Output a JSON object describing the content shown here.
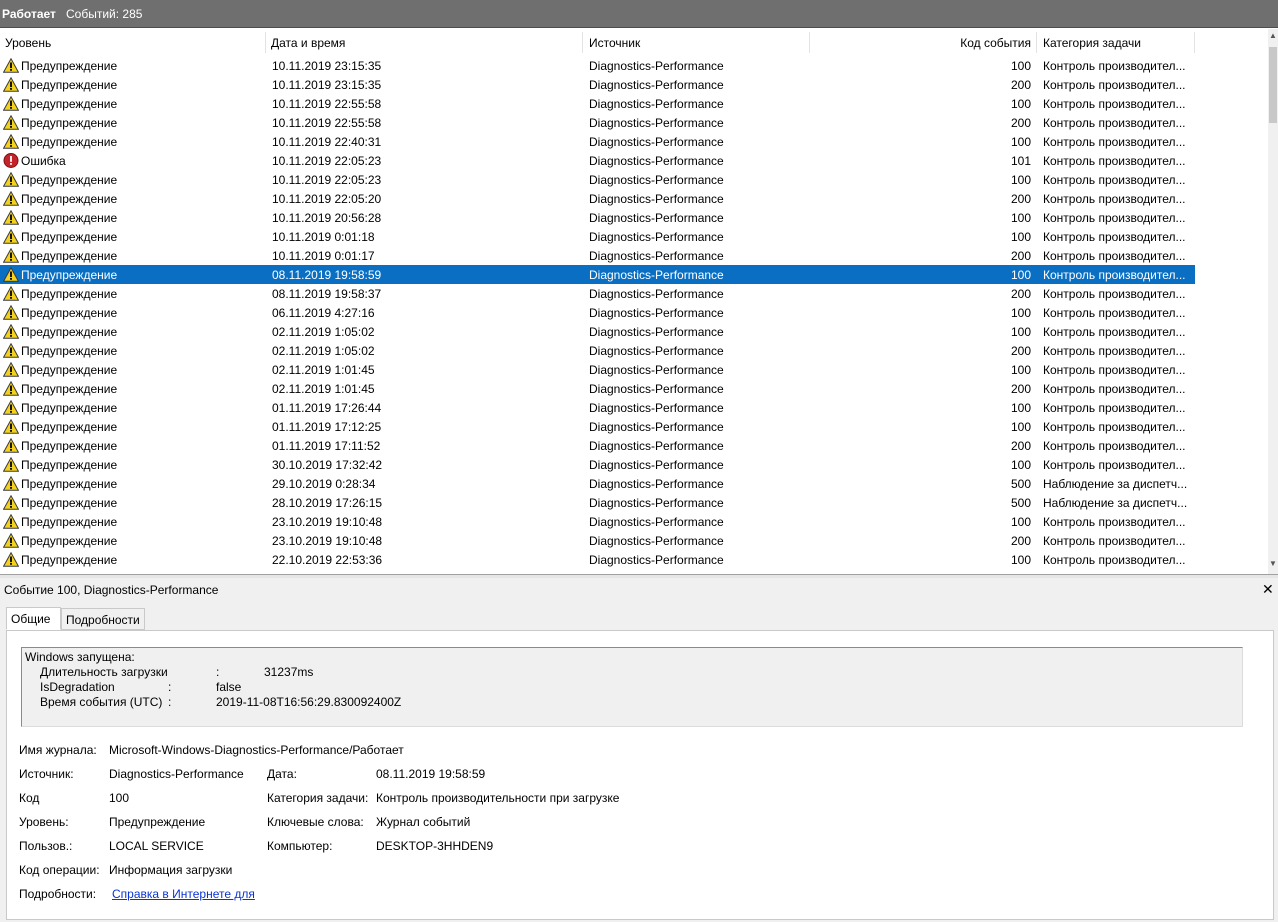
{
  "titlebar": {
    "status": "Работает",
    "events_count": "Событий: 285"
  },
  "columns": {
    "level": "Уровень",
    "date": "Дата и время",
    "source": "Источник",
    "id": "Код события",
    "category": "Категория задачи"
  },
  "rows": [
    {
      "type": "warning",
      "level": "Предупреждение",
      "date": "10.11.2019 23:15:35",
      "source": "Diagnostics-Performance",
      "id": "100",
      "category": "Контроль производител..."
    },
    {
      "type": "warning",
      "level": "Предупреждение",
      "date": "10.11.2019 23:15:35",
      "source": "Diagnostics-Performance",
      "id": "200",
      "category": "Контроль производител..."
    },
    {
      "type": "warning",
      "level": "Предупреждение",
      "date": "10.11.2019 22:55:58",
      "source": "Diagnostics-Performance",
      "id": "100",
      "category": "Контроль производител..."
    },
    {
      "type": "warning",
      "level": "Предупреждение",
      "date": "10.11.2019 22:55:58",
      "source": "Diagnostics-Performance",
      "id": "200",
      "category": "Контроль производител..."
    },
    {
      "type": "warning",
      "level": "Предупреждение",
      "date": "10.11.2019 22:40:31",
      "source": "Diagnostics-Performance",
      "id": "100",
      "category": "Контроль производител..."
    },
    {
      "type": "error",
      "level": "Ошибка",
      "date": "10.11.2019 22:05:23",
      "source": "Diagnostics-Performance",
      "id": "101",
      "category": "Контроль производител..."
    },
    {
      "type": "warning",
      "level": "Предупреждение",
      "date": "10.11.2019 22:05:23",
      "source": "Diagnostics-Performance",
      "id": "100",
      "category": "Контроль производител..."
    },
    {
      "type": "warning",
      "level": "Предупреждение",
      "date": "10.11.2019 22:05:20",
      "source": "Diagnostics-Performance",
      "id": "200",
      "category": "Контроль производител..."
    },
    {
      "type": "warning",
      "level": "Предупреждение",
      "date": "10.11.2019 20:56:28",
      "source": "Diagnostics-Performance",
      "id": "100",
      "category": "Контроль производител..."
    },
    {
      "type": "warning",
      "level": "Предупреждение",
      "date": "10.11.2019 0:01:18",
      "source": "Diagnostics-Performance",
      "id": "100",
      "category": "Контроль производител..."
    },
    {
      "type": "warning",
      "level": "Предупреждение",
      "date": "10.11.2019 0:01:17",
      "source": "Diagnostics-Performance",
      "id": "200",
      "category": "Контроль производител..."
    },
    {
      "type": "warning",
      "level": "Предупреждение",
      "date": "08.11.2019 19:58:59",
      "source": "Diagnostics-Performance",
      "id": "100",
      "category": "Контроль производител...",
      "selected": true
    },
    {
      "type": "warning",
      "level": "Предупреждение",
      "date": "08.11.2019 19:58:37",
      "source": "Diagnostics-Performance",
      "id": "200",
      "category": "Контроль производител..."
    },
    {
      "type": "warning",
      "level": "Предупреждение",
      "date": "06.11.2019 4:27:16",
      "source": "Diagnostics-Performance",
      "id": "100",
      "category": "Контроль производител..."
    },
    {
      "type": "warning",
      "level": "Предупреждение",
      "date": "02.11.2019 1:05:02",
      "source": "Diagnostics-Performance",
      "id": "100",
      "category": "Контроль производител..."
    },
    {
      "type": "warning",
      "level": "Предупреждение",
      "date": "02.11.2019 1:05:02",
      "source": "Diagnostics-Performance",
      "id": "200",
      "category": "Контроль производител..."
    },
    {
      "type": "warning",
      "level": "Предупреждение",
      "date": "02.11.2019 1:01:45",
      "source": "Diagnostics-Performance",
      "id": "100",
      "category": "Контроль производител..."
    },
    {
      "type": "warning",
      "level": "Предупреждение",
      "date": "02.11.2019 1:01:45",
      "source": "Diagnostics-Performance",
      "id": "200",
      "category": "Контроль производител..."
    },
    {
      "type": "warning",
      "level": "Предупреждение",
      "date": "01.11.2019 17:26:44",
      "source": "Diagnostics-Performance",
      "id": "100",
      "category": "Контроль производител..."
    },
    {
      "type": "warning",
      "level": "Предупреждение",
      "date": "01.11.2019 17:12:25",
      "source": "Diagnostics-Performance",
      "id": "100",
      "category": "Контроль производител..."
    },
    {
      "type": "warning",
      "level": "Предупреждение",
      "date": "01.11.2019 17:11:52",
      "source": "Diagnostics-Performance",
      "id": "200",
      "category": "Контроль производител..."
    },
    {
      "type": "warning",
      "level": "Предупреждение",
      "date": "30.10.2019 17:32:42",
      "source": "Diagnostics-Performance",
      "id": "100",
      "category": "Контроль производител..."
    },
    {
      "type": "warning",
      "level": "Предупреждение",
      "date": "29.10.2019 0:28:34",
      "source": "Diagnostics-Performance",
      "id": "500",
      "category": "Наблюдение за диспетч..."
    },
    {
      "type": "warning",
      "level": "Предупреждение",
      "date": "28.10.2019 17:26:15",
      "source": "Diagnostics-Performance",
      "id": "500",
      "category": "Наблюдение за диспетч..."
    },
    {
      "type": "warning",
      "level": "Предупреждение",
      "date": "23.10.2019 19:10:48",
      "source": "Diagnostics-Performance",
      "id": "100",
      "category": "Контроль производител..."
    },
    {
      "type": "warning",
      "level": "Предупреждение",
      "date": "23.10.2019 19:10:48",
      "source": "Diagnostics-Performance",
      "id": "200",
      "category": "Контроль производител..."
    },
    {
      "type": "warning",
      "level": "Предупреждение",
      "date": "22.10.2019 22:53:36",
      "source": "Diagnostics-Performance",
      "id": "100",
      "category": "Контроль производител..."
    }
  ],
  "detail": {
    "title": "Событие 100, Diagnostics-Performance",
    "tabs": {
      "general": "Общие",
      "details": "Подробности"
    },
    "message": {
      "line1": "Windows запущена:",
      "boot_label": "Длительность загрузки",
      "boot_value": "31237ms",
      "degr_label": "IsDegradation",
      "degr_value": "false",
      "time_label": "Время события (UTC)",
      "time_value": "2019-11-08T16:56:29.830092400Z",
      "colon": ":"
    },
    "props": {
      "log_label": "Имя журнала:",
      "log_value": "Microsoft-Windows-Diagnostics-Performance/Работает",
      "source_label": "Источник:",
      "source_value": "Diagnostics-Performance",
      "date_label": "Дата:",
      "date_value": "08.11.2019 19:58:59",
      "code_label": "Код",
      "code_value": "100",
      "category_label": "Категория задачи:",
      "category_value": "Контроль производительности при загрузке",
      "level_label": "Уровень:",
      "level_value": "Предупреждение",
      "keywords_label": "Ключевые слова:",
      "keywords_value": "Журнал событий",
      "user_label": "Пользов.:",
      "user_value": "LOCAL SERVICE",
      "computer_label": "Компьютер:",
      "computer_value": "DESKTOP-3HHDEN9",
      "opcode_label": "Код операции:",
      "opcode_value": "Информация загрузки",
      "details_label": "Подробности:",
      "details_link": "Справка в Интернете для"
    }
  }
}
